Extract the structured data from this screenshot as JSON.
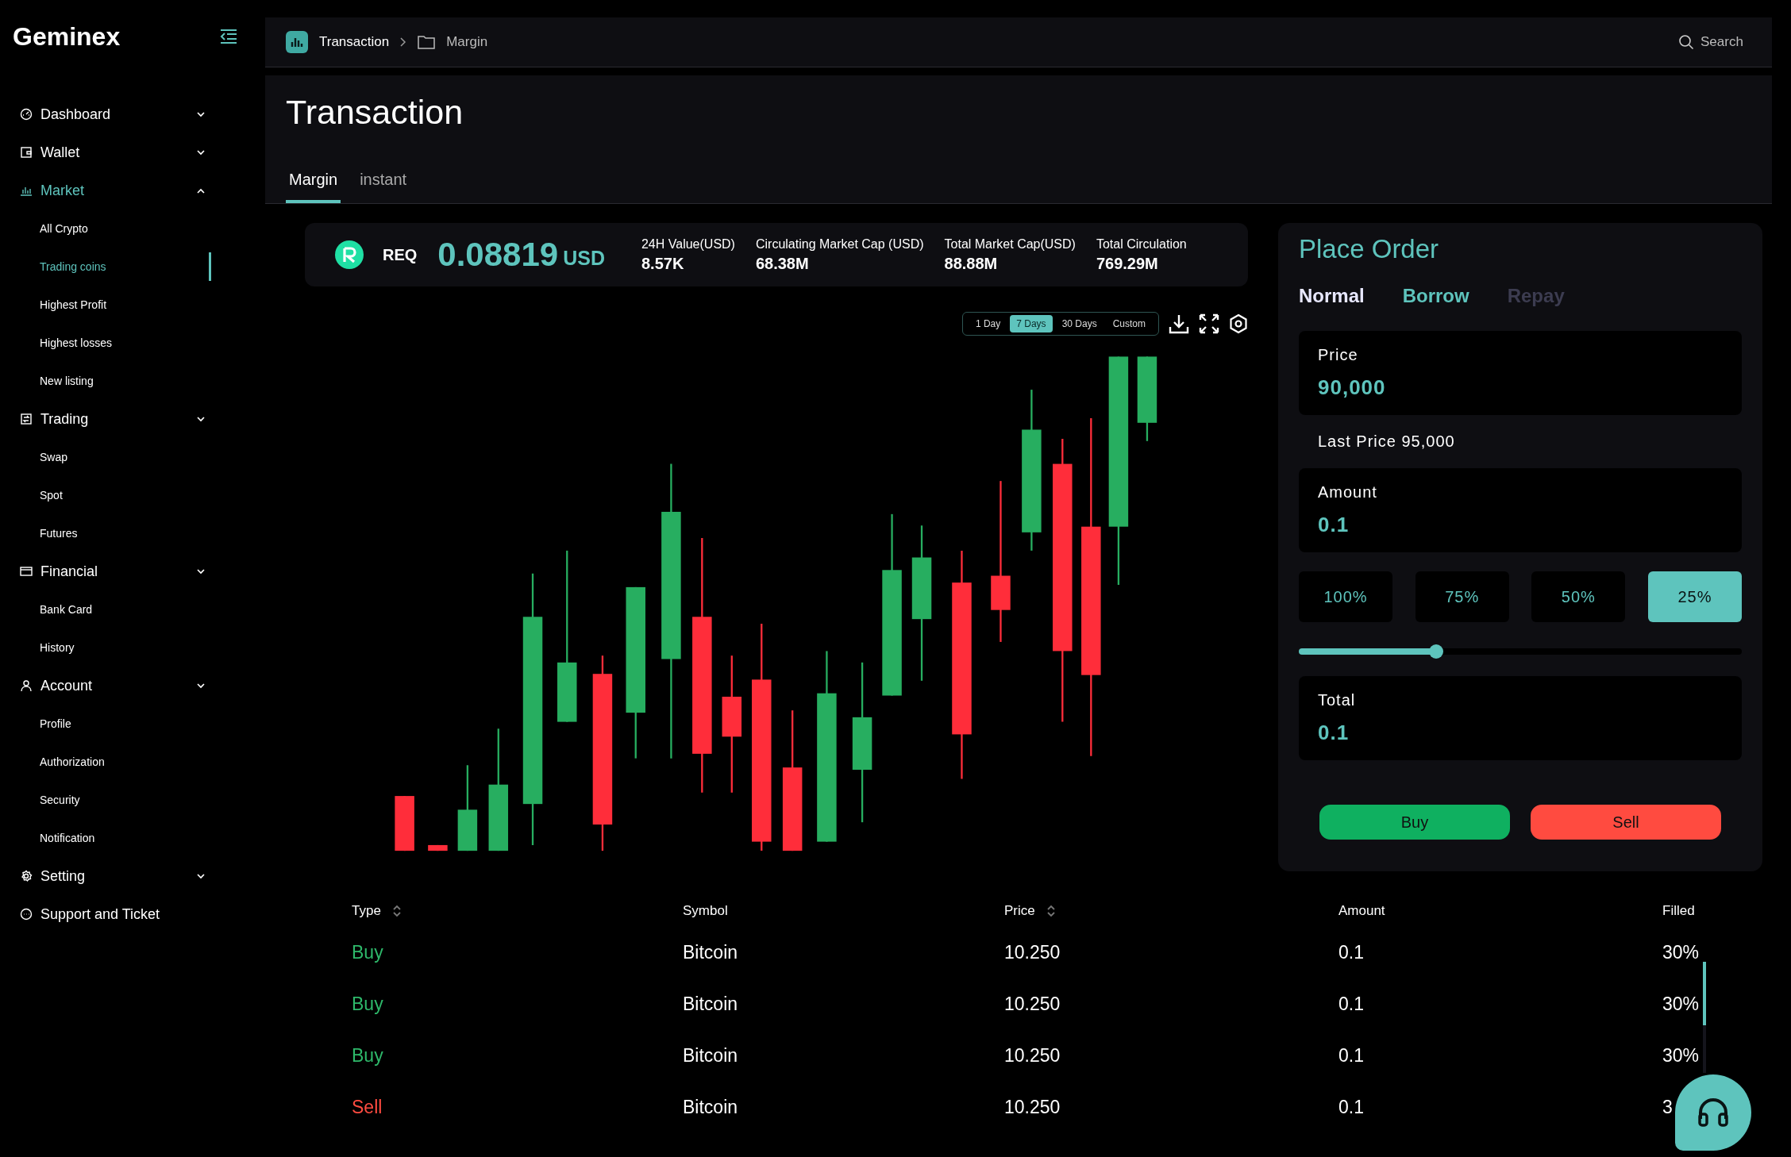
{
  "app": {
    "name": "Geminex"
  },
  "sidebar": {
    "items": [
      {
        "label": "Dashboard",
        "expanded": false,
        "selected": false
      },
      {
        "label": "Wallet",
        "expanded": false,
        "selected": false
      },
      {
        "label": "Market",
        "expanded": true,
        "selected": true,
        "children": [
          {
            "label": "All Crypto",
            "selected": false
          },
          {
            "label": "Trading coins",
            "selected": true
          },
          {
            "label": "Highest Profit",
            "selected": false
          },
          {
            "label": "Highest losses",
            "selected": false
          },
          {
            "label": "New listing",
            "selected": false
          }
        ]
      },
      {
        "label": "Trading",
        "expanded": false,
        "selected": false,
        "children": [
          {
            "label": "Swap",
            "selected": false
          },
          {
            "label": "Spot",
            "selected": false
          },
          {
            "label": "Futures",
            "selected": false
          }
        ]
      },
      {
        "label": "Financial",
        "expanded": false,
        "selected": false,
        "children": [
          {
            "label": "Bank Card",
            "selected": false
          },
          {
            "label": "History",
            "selected": false
          }
        ]
      },
      {
        "label": "Account",
        "expanded": false,
        "selected": false,
        "children": [
          {
            "label": "Profile",
            "selected": false
          },
          {
            "label": "Authorization",
            "selected": false
          },
          {
            "label": "Security",
            "selected": false
          },
          {
            "label": "Notification",
            "selected": false
          }
        ]
      },
      {
        "label": "Setting",
        "expanded": false,
        "selected": false
      },
      {
        "label": "Support and Ticket",
        "selected": false
      }
    ]
  },
  "breadcrumb": [
    "Transaction",
    "Margin"
  ],
  "search": {
    "placeholder": "Search"
  },
  "page": {
    "title": "Transaction",
    "tabs": [
      {
        "label": "Margin",
        "selected": true
      },
      {
        "label": "instant",
        "selected": false
      }
    ]
  },
  "ticker": {
    "symbol": "REQ",
    "price": "0.08819",
    "currency": "USD",
    "stats": [
      {
        "label": "24H Value(USD)",
        "value": "8.57K"
      },
      {
        "label": "Circulating Market Cap (USD)",
        "value": "68.38M"
      },
      {
        "label": "Total Market Cap(USD)",
        "value": "88.88M"
      },
      {
        "label": "Total Circulation",
        "value": "769.29M"
      }
    ]
  },
  "chart": {
    "ranges": [
      {
        "label": "1 Day",
        "selected": false
      },
      {
        "label": "7 Days",
        "selected": true
      },
      {
        "label": "30 Days",
        "selected": false
      },
      {
        "label": "Custom",
        "selected": false
      }
    ]
  },
  "order": {
    "title": "Place Order",
    "modes": [
      {
        "label": "Normal",
        "selected": true,
        "disabled": false
      },
      {
        "label": "Borrow",
        "selected": false,
        "disabled": false
      },
      {
        "label": "Repay",
        "selected": false,
        "disabled": true
      }
    ],
    "price": {
      "label": "Price",
      "value": "90,000"
    },
    "last_price": "Last Price 95,000",
    "amount": {
      "label": "Amount",
      "value": "0.1"
    },
    "percents": [
      {
        "label": "100%",
        "selected": false
      },
      {
        "label": "75%",
        "selected": false
      },
      {
        "label": "50%",
        "selected": false
      },
      {
        "label": "25%",
        "selected": true
      }
    ],
    "slider": {
      "level": 0.31
    },
    "total": {
      "label": "Total",
      "value": "0.1"
    },
    "buttons": [
      {
        "label": "Buy",
        "kind": "buy"
      },
      {
        "label": "Sell",
        "kind": "sell"
      }
    ]
  },
  "table": {
    "columns": [
      {
        "label": "Type",
        "sortable": true
      },
      {
        "label": "Symbol",
        "sortable": false
      },
      {
        "label": "Price",
        "sortable": true
      },
      {
        "label": "Amount",
        "sortable": false
      },
      {
        "label": "Filled",
        "sortable": false
      }
    ],
    "rows": [
      {
        "type": "Buy",
        "kind": "buy",
        "symbol": "Bitcoin",
        "price": "10.250",
        "amount": "0.1",
        "filled": "30%"
      },
      {
        "type": "Buy",
        "kind": "buy",
        "symbol": "Bitcoin",
        "price": "10.250",
        "amount": "0.1",
        "filled": "30%"
      },
      {
        "type": "Buy",
        "kind": "buy",
        "symbol": "Bitcoin",
        "price": "10.250",
        "amount": "0.1",
        "filled": "30%"
      },
      {
        "type": "Sell",
        "kind": "sell",
        "symbol": "Bitcoin",
        "price": "10.250",
        "amount": "0.1",
        "filled": "3"
      }
    ]
  }
}
